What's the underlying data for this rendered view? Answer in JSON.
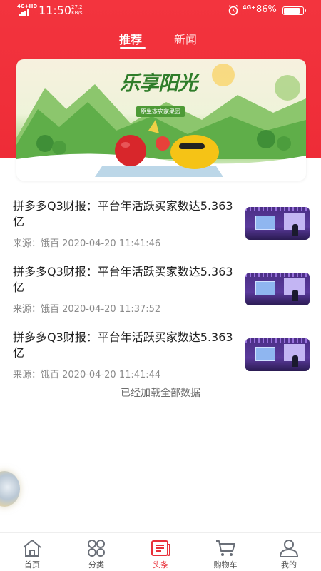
{
  "status_bar": {
    "network": "4G+HD",
    "time": "11:50",
    "speed_value": "27.2",
    "speed_unit": "KB/s",
    "network2": "4G+",
    "battery_text": "86%",
    "battery_level": 0.86
  },
  "top_tabs": [
    {
      "label": "推荐",
      "active": true
    },
    {
      "label": "新闻",
      "active": false
    }
  ],
  "banner": {
    "title": "乐享阳光",
    "subtitle": "原生态农家果园"
  },
  "news": [
    {
      "title": "拼多多Q3财报：平台年活跃买家数达5.363亿",
      "meta": "来源：饿百 2020-04-20 11:41:46"
    },
    {
      "title": "拼多多Q3财报：平台年活跃买家数达5.363亿",
      "meta": "来源：饿百 2020-04-20 11:37:52"
    },
    {
      "title": "拼多多Q3财报：平台年活跃买家数达5.363亿",
      "meta": "来源：饿百 2020-04-20 11:41:44"
    }
  ],
  "load_complete": "已经加载全部数据",
  "bottom_nav": [
    {
      "label": "首页",
      "icon": "home-icon"
    },
    {
      "label": "分类",
      "icon": "category-icon"
    },
    {
      "label": "头条",
      "icon": "headline-icon",
      "active": true
    },
    {
      "label": "购物车",
      "icon": "cart-icon"
    },
    {
      "label": "我的",
      "icon": "user-icon"
    }
  ],
  "colors": {
    "accent": "#ee2c37",
    "active_nav": "#e8303a"
  }
}
